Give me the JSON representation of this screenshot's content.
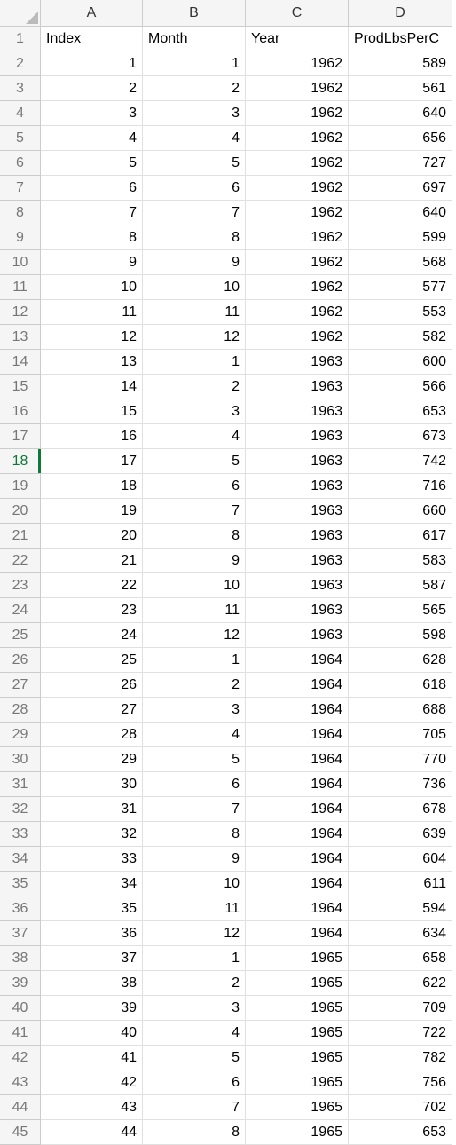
{
  "columns": [
    "A",
    "B",
    "C",
    "D"
  ],
  "selectedRow": 18,
  "headers": {
    "A": "Index",
    "B": "Month",
    "C": "Year",
    "D": "ProdLbsPerC"
  },
  "rows": [
    {
      "r": 2,
      "A": 1,
      "B": 1,
      "C": 1962,
      "D": 589
    },
    {
      "r": 3,
      "A": 2,
      "B": 2,
      "C": 1962,
      "D": 561
    },
    {
      "r": 4,
      "A": 3,
      "B": 3,
      "C": 1962,
      "D": 640
    },
    {
      "r": 5,
      "A": 4,
      "B": 4,
      "C": 1962,
      "D": 656
    },
    {
      "r": 6,
      "A": 5,
      "B": 5,
      "C": 1962,
      "D": 727
    },
    {
      "r": 7,
      "A": 6,
      "B": 6,
      "C": 1962,
      "D": 697
    },
    {
      "r": 8,
      "A": 7,
      "B": 7,
      "C": 1962,
      "D": 640
    },
    {
      "r": 9,
      "A": 8,
      "B": 8,
      "C": 1962,
      "D": 599
    },
    {
      "r": 10,
      "A": 9,
      "B": 9,
      "C": 1962,
      "D": 568
    },
    {
      "r": 11,
      "A": 10,
      "B": 10,
      "C": 1962,
      "D": 577
    },
    {
      "r": 12,
      "A": 11,
      "B": 11,
      "C": 1962,
      "D": 553
    },
    {
      "r": 13,
      "A": 12,
      "B": 12,
      "C": 1962,
      "D": 582
    },
    {
      "r": 14,
      "A": 13,
      "B": 1,
      "C": 1963,
      "D": 600
    },
    {
      "r": 15,
      "A": 14,
      "B": 2,
      "C": 1963,
      "D": 566
    },
    {
      "r": 16,
      "A": 15,
      "B": 3,
      "C": 1963,
      "D": 653
    },
    {
      "r": 17,
      "A": 16,
      "B": 4,
      "C": 1963,
      "D": 673
    },
    {
      "r": 18,
      "A": 17,
      "B": 5,
      "C": 1963,
      "D": 742
    },
    {
      "r": 19,
      "A": 18,
      "B": 6,
      "C": 1963,
      "D": 716
    },
    {
      "r": 20,
      "A": 19,
      "B": 7,
      "C": 1963,
      "D": 660
    },
    {
      "r": 21,
      "A": 20,
      "B": 8,
      "C": 1963,
      "D": 617
    },
    {
      "r": 22,
      "A": 21,
      "B": 9,
      "C": 1963,
      "D": 583
    },
    {
      "r": 23,
      "A": 22,
      "B": 10,
      "C": 1963,
      "D": 587
    },
    {
      "r": 24,
      "A": 23,
      "B": 11,
      "C": 1963,
      "D": 565
    },
    {
      "r": 25,
      "A": 24,
      "B": 12,
      "C": 1963,
      "D": 598
    },
    {
      "r": 26,
      "A": 25,
      "B": 1,
      "C": 1964,
      "D": 628
    },
    {
      "r": 27,
      "A": 26,
      "B": 2,
      "C": 1964,
      "D": 618
    },
    {
      "r": 28,
      "A": 27,
      "B": 3,
      "C": 1964,
      "D": 688
    },
    {
      "r": 29,
      "A": 28,
      "B": 4,
      "C": 1964,
      "D": 705
    },
    {
      "r": 30,
      "A": 29,
      "B": 5,
      "C": 1964,
      "D": 770
    },
    {
      "r": 31,
      "A": 30,
      "B": 6,
      "C": 1964,
      "D": 736
    },
    {
      "r": 32,
      "A": 31,
      "B": 7,
      "C": 1964,
      "D": 678
    },
    {
      "r": 33,
      "A": 32,
      "B": 8,
      "C": 1964,
      "D": 639
    },
    {
      "r": 34,
      "A": 33,
      "B": 9,
      "C": 1964,
      "D": 604
    },
    {
      "r": 35,
      "A": 34,
      "B": 10,
      "C": 1964,
      "D": 611
    },
    {
      "r": 36,
      "A": 35,
      "B": 11,
      "C": 1964,
      "D": 594
    },
    {
      "r": 37,
      "A": 36,
      "B": 12,
      "C": 1964,
      "D": 634
    },
    {
      "r": 38,
      "A": 37,
      "B": 1,
      "C": 1965,
      "D": 658
    },
    {
      "r": 39,
      "A": 38,
      "B": 2,
      "C": 1965,
      "D": 622
    },
    {
      "r": 40,
      "A": 39,
      "B": 3,
      "C": 1965,
      "D": 709
    },
    {
      "r": 41,
      "A": 40,
      "B": 4,
      "C": 1965,
      "D": 722
    },
    {
      "r": 42,
      "A": 41,
      "B": 5,
      "C": 1965,
      "D": 782
    },
    {
      "r": 43,
      "A": 42,
      "B": 6,
      "C": 1965,
      "D": 756
    },
    {
      "r": 44,
      "A": 43,
      "B": 7,
      "C": 1965,
      "D": 702
    },
    {
      "r": 45,
      "A": 44,
      "B": 8,
      "C": 1965,
      "D": 653
    }
  ]
}
